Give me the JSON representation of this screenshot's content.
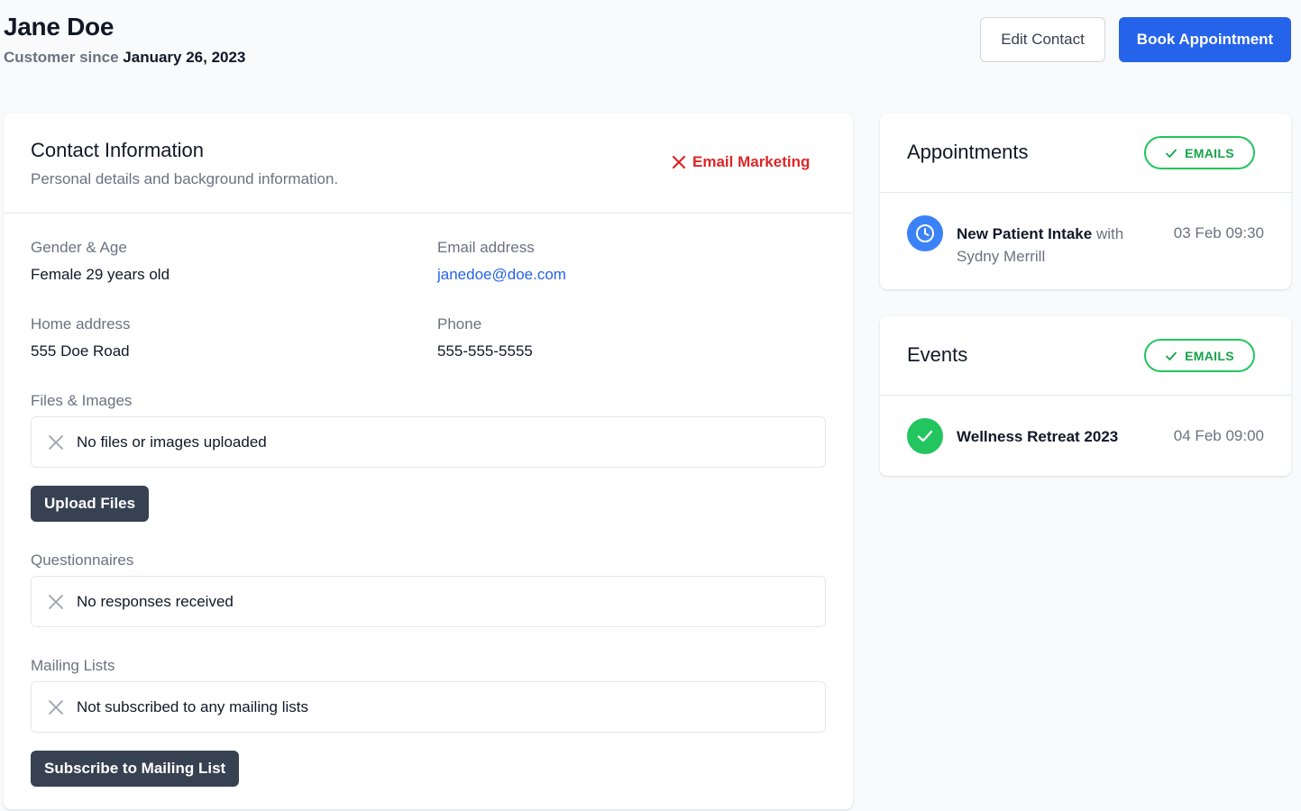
{
  "header": {
    "name": "Jane Doe",
    "customer_since_label": "Customer since",
    "customer_since_date": "January 26, 2023",
    "edit_label": "Edit Contact",
    "book_label": "Book Appointment"
  },
  "contact": {
    "title": "Contact Information",
    "description": "Personal details and background information.",
    "email_marketing_label": "Email Marketing",
    "fields": {
      "gender_age_label": "Gender & Age",
      "gender_age_value": "Female 29 years old",
      "email_label": "Email address",
      "email_value": "janedoe@doe.com",
      "home_label": "Home address",
      "home_value": "555 Doe Road",
      "phone_label": "Phone",
      "phone_value": "555-555-5555"
    },
    "files": {
      "label": "Files & Images",
      "empty": "No files or images uploaded",
      "button": "Upload Files"
    },
    "questionnaires": {
      "label": "Questionnaires",
      "empty": "No responses received"
    },
    "mailing": {
      "label": "Mailing Lists",
      "empty": "Not subscribed to any mailing lists",
      "button": "Subscribe to Mailing List"
    }
  },
  "appointments": {
    "title": "Appointments",
    "badge": "EMAILS",
    "item": {
      "name": "New Patient Intake",
      "with": "with",
      "person": "Sydny Merrill",
      "date": "03 Feb 09:30",
      "icon": "clock-icon"
    }
  },
  "events": {
    "title": "Events",
    "badge": "EMAILS",
    "item": {
      "name": "Wellness Retreat 2023",
      "date": "04 Feb 09:00",
      "icon": "check-icon"
    }
  },
  "colors": {
    "primary": "#2563eb",
    "dark_button": "#374151",
    "danger": "#dc2626",
    "success": "#22c55e"
  }
}
